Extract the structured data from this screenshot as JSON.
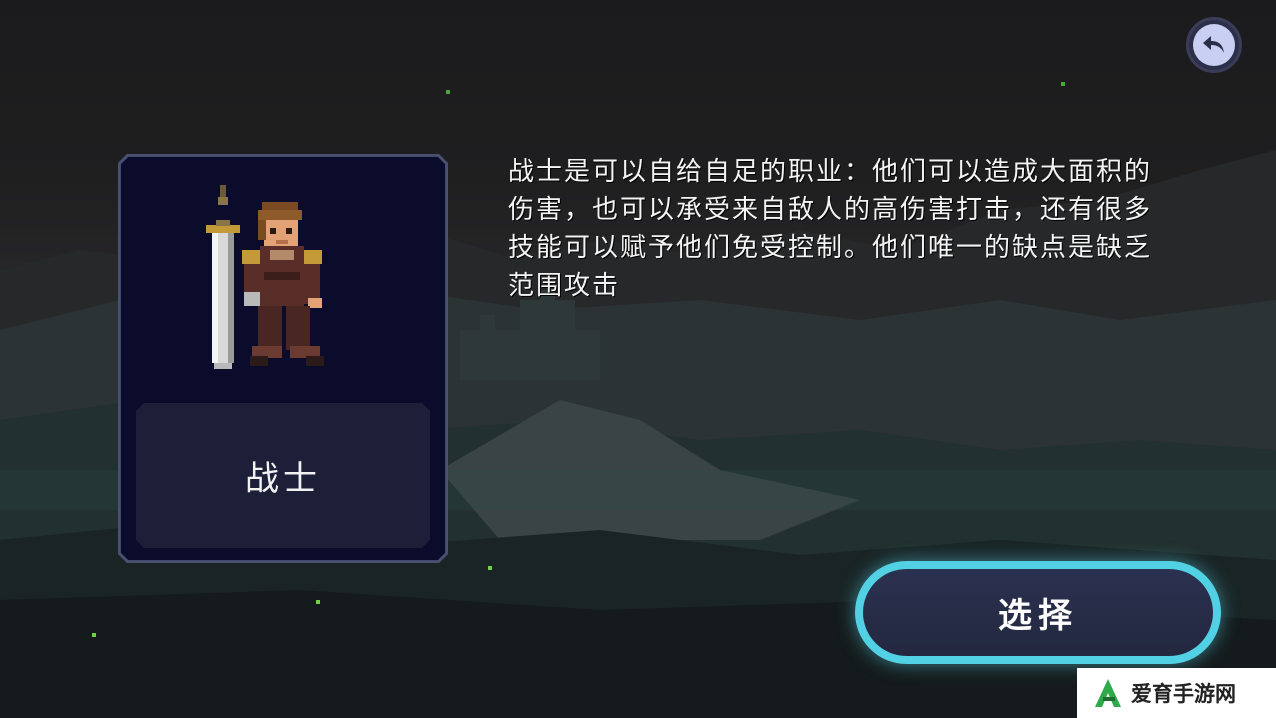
{
  "class_card": {
    "name": "战士"
  },
  "description": "战士是可以自给自足的职业：他们可以造成大面积的伤害，也可以承受来自敌人的高伤害打击，还有很多技能可以赋予他们免受控制。他们唯一的缺点是缺乏范围攻击",
  "select_button": {
    "label": "选择"
  },
  "back_button": {
    "icon": "back-arrow-icon"
  },
  "watermark": {
    "text": "爱育手游网"
  },
  "colors": {
    "accent": "#52d0e4",
    "card_bg": "#0b0c2c",
    "card_border": "#3b4166",
    "back_button": "#c9cff3"
  }
}
